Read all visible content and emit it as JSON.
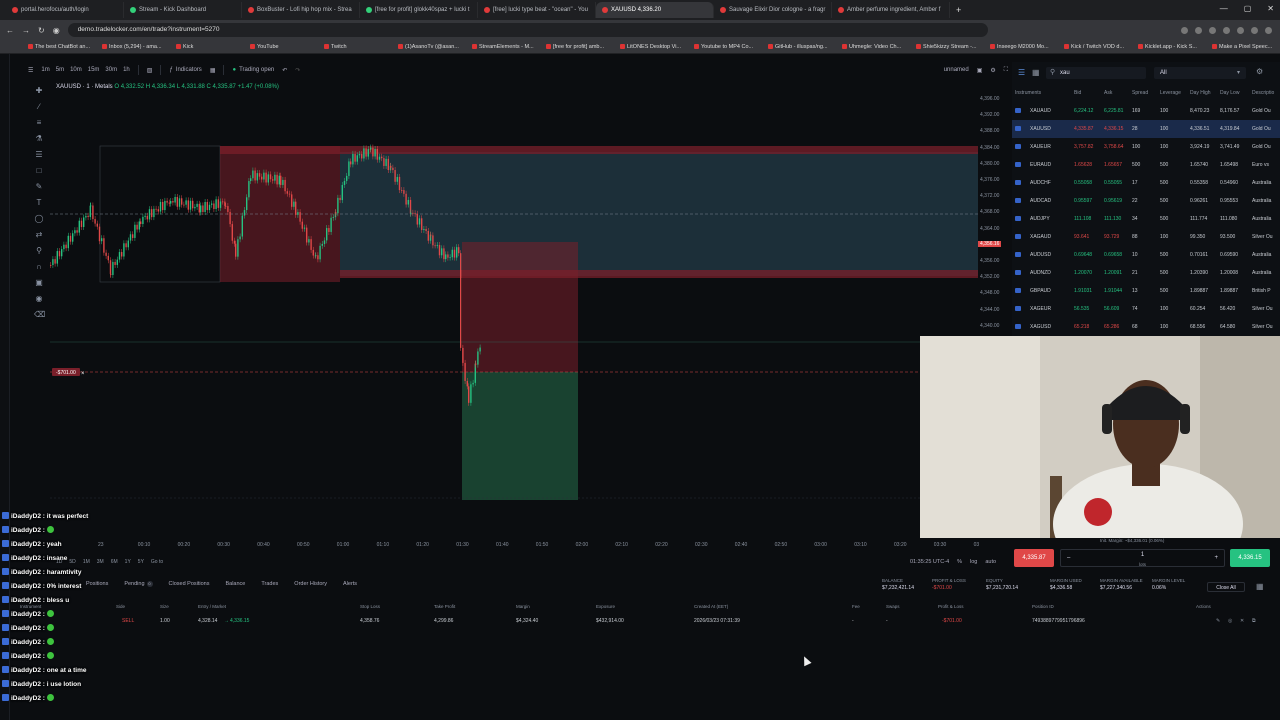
{
  "browser": {
    "tabs": [
      {
        "title": "portal.herofocu/auth/login",
        "active": false
      },
      {
        "title": "Stream - Kick Dashboard",
        "active": false
      },
      {
        "title": "BoxBuster - Lofi hip hop mix - Strea",
        "active": false
      },
      {
        "title": "[free for profit] glokk40spaz + lucki t",
        "active": false
      },
      {
        "title": "[free] lucki type beat - \"ocean\" - You",
        "active": false
      },
      {
        "title": "XAUUSD 4,336.20",
        "active": true
      },
      {
        "title": "Sauvage Elixir Dior cologne - a fragr",
        "active": false
      },
      {
        "title": "Amber perfume ingredient, Amber f",
        "active": false
      }
    ],
    "url": "demo.tradelocker.com/en/trade?instrument=5270",
    "bookmarks": [
      "The best ChatBot an...",
      "Inbox (5,294) - ama...",
      "Kick",
      "YouTube",
      "Twitch",
      "(1)AsanoTv (@asan...",
      "StreamElements - M...",
      "[free for profit] amb...",
      "LitONES Desktop Vi...",
      "Youtube to MP4 Co...",
      "GitHub - illuspas/ng...",
      "Uhmegle: Video Ch...",
      "Shie5kizzy Stream -...",
      "Inseego M2000 Mo...",
      "Kick / Twitch VOD d...",
      "Kicklet.app - Kick S...",
      "Make a Pixel Speec..."
    ]
  },
  "toolbar": {
    "timeframes": [
      "1m",
      "5m",
      "10m",
      "15m",
      "30m",
      "1h"
    ],
    "indicators_label": "Indicators",
    "trading_status": "Trading open",
    "layout_name": "unnamed"
  },
  "symbol": {
    "title": "XAUUSD · 1 · Metals",
    "ohlc": "O 4,332.52  H 4,336.34  L 4,331.88  C 4,335.87  +1.47 (+0.08%)"
  },
  "chart_data": {
    "type": "candlestick",
    "y_ticks": [
      "4,396.00",
      "4,392.00",
      "4,388.00",
      "4,384.00",
      "4,380.00",
      "4,376.00",
      "4,372.00",
      "4,368.00",
      "4,364.00",
      "4,360.00",
      "4,356.00",
      "4,352.00",
      "4,348.00",
      "4,344.00",
      "4,340.00"
    ],
    "x_ticks": [
      "23",
      "00:10",
      "00:20",
      "00:30",
      "00:40",
      "00:50",
      "01:00",
      "01:10",
      "01:20",
      "01:30",
      "01:40",
      "01:50",
      "02:00",
      "02:10",
      "02:20",
      "02:30",
      "02:40",
      "02:50",
      "03:00",
      "03:10",
      "03:20",
      "03:30",
      "03"
    ],
    "current_price_tag": "4,356.16",
    "position_tag": "-$701.00",
    "time_label": "01:35:25 UTC-4",
    "footer_opts": [
      "%",
      "log",
      "auto"
    ],
    "range_buttons": [
      "1D",
      "5D",
      "1M",
      "3M",
      "6M",
      "1Y",
      "5Y",
      "Go to"
    ]
  },
  "instruments": {
    "search": "xau",
    "filter": "All",
    "columns": [
      "Instruments",
      "Bid",
      "Ask",
      "Spread",
      "Leverage",
      "Day High",
      "Day Low",
      "Descriptio"
    ],
    "rows": [
      {
        "sym": "XAUAUD",
        "bid": "6,224.12",
        "ask": "6,225.81",
        "spread": "169",
        "lev": "100",
        "hi": "8,470.23",
        "lo": "8,176.57",
        "desc": "Gold Ou",
        "up": true,
        "sel": false
      },
      {
        "sym": "XAUUSD",
        "bid": "4,335.87",
        "ask": "4,336.15",
        "spread": "28",
        "lev": "100",
        "hi": "4,336.51",
        "lo": "4,319.84",
        "desc": "Gold Ou",
        "up": false,
        "sel": true
      },
      {
        "sym": "XAUEUR",
        "bid": "3,757.82",
        "ask": "3,758.64",
        "spread": "100",
        "lev": "100",
        "hi": "3,924.19",
        "lo": "3,741.49",
        "desc": "Gold Ou",
        "up": false,
        "sel": false
      },
      {
        "sym": "EURAUD",
        "bid": "1.65628",
        "ask": "1.65657",
        "spread": "500",
        "lev": "500",
        "hi": "1.65740",
        "lo": "1.65498",
        "desc": "Euro vs",
        "up": false,
        "sel": false
      },
      {
        "sym": "AUDCHF",
        "bid": "0.55058",
        "ask": "0.55055",
        "spread": "17",
        "lev": "500",
        "hi": "0.55358",
        "lo": "0.54960",
        "desc": "Australia",
        "up": true,
        "sel": false
      },
      {
        "sym": "AUDCAD",
        "bid": "0.95597",
        "ask": "0.95619",
        "spread": "22",
        "lev": "500",
        "hi": "0.96261",
        "lo": "0.95553",
        "desc": "Australia",
        "up": true,
        "sel": false
      },
      {
        "sym": "AUDJPY",
        "bid": "111.108",
        "ask": "111.130",
        "spread": "34",
        "lev": "500",
        "hi": "111.774",
        "lo": "111.080",
        "desc": "Australia",
        "up": true,
        "sel": false
      },
      {
        "sym": "XAGAUD",
        "bid": "93.641",
        "ask": "93.729",
        "spread": "88",
        "lev": "100",
        "hi": "99.350",
        "lo": "93.500",
        "desc": "Silver Ou",
        "up": false,
        "sel": false
      },
      {
        "sym": "AUDUSD",
        "bid": "0.69648",
        "ask": "0.69658",
        "spread": "10",
        "lev": "500",
        "hi": "0.70161",
        "lo": "0.69590",
        "desc": "Australia",
        "up": true,
        "sel": false
      },
      {
        "sym": "AUDNZD",
        "bid": "1.20070",
        "ask": "1.20091",
        "spread": "21",
        "lev": "500",
        "hi": "1.20390",
        "lo": "1.20008",
        "desc": "Australia",
        "up": true,
        "sel": false
      },
      {
        "sym": "GBPAUD",
        "bid": "1.91031",
        "ask": "1.91044",
        "spread": "13",
        "lev": "500",
        "hi": "1.89887",
        "lo": "1.89887",
        "desc": "British P",
        "up": true,
        "sel": false
      },
      {
        "sym": "XAGEUR",
        "bid": "56.535",
        "ask": "56.609",
        "spread": "74",
        "lev": "100",
        "hi": "60.254",
        "lo": "56.420",
        "desc": "Silver Ou",
        "up": true,
        "sel": false
      },
      {
        "sym": "XAGUSD",
        "bid": "65.218",
        "ask": "65.286",
        "spread": "68",
        "lev": "100",
        "hi": "68.556",
        "lo": "64.580",
        "desc": "Silver Ou",
        "up": false,
        "sel": false
      }
    ]
  },
  "ticket": {
    "sell_price": "4,335.87",
    "sell_label": "Sell",
    "buy_price": "4,336.15",
    "buy_label": "Buy",
    "lots": "1",
    "lots_unit": "lots",
    "margin_note": "Init. Margin: ~$4,336.01 (0.06%)"
  },
  "bottom": {
    "tabs": [
      "Positions",
      "Pending",
      "Closed Positions",
      "Balance",
      "Trades",
      "Order History",
      "Alerts"
    ],
    "pending_count": "0",
    "account": [
      {
        "label": "BALANCE",
        "value": "$7,232,421.14",
        "neg": false
      },
      {
        "label": "PROFIT & LOSS",
        "value": "-$701.00",
        "neg": true
      },
      {
        "label": "EQUITY",
        "value": "$7,231,720.14",
        "neg": false
      },
      {
        "label": "MARGIN USED",
        "value": "$4,336.58",
        "neg": false
      },
      {
        "label": "MARGIN AVAILABLE",
        "value": "$7,227,340.56",
        "neg": false
      },
      {
        "label": "MARGIN LEVEL",
        "value": "0.06%",
        "neg": false
      }
    ],
    "close_all": "Close All",
    "columns": [
      "Instrument",
      "Side",
      "Size",
      "Entry / Market",
      "Stop Loss",
      "Take Profit",
      "Margin",
      "Exposure",
      "Created At (EET)",
      "Fee",
      "Swaps",
      "Profit & Loss",
      "Position ID",
      "Actions"
    ],
    "position": {
      "side": "SELL",
      "size": "1.00",
      "entry": "4,328.14",
      "market": "4,336.15",
      "sl": "4,358.76",
      "tp": "4,299.86",
      "margin": "$4,324.40",
      "exposure": "$432,914.00",
      "created": "2026/03/23 07:31:39",
      "fee": "-",
      "swaps": "-",
      "pnl": "-$701.00",
      "id": "7493889779951796896"
    }
  },
  "chat": [
    {
      "user": "iDaddyD2",
      "text": "it was perfect"
    },
    {
      "user": "iDaddyD2",
      "text": ""
    },
    {
      "user": "iDaddyD2",
      "text": "yeah"
    },
    {
      "user": "iDaddyD2",
      "text": "insane"
    },
    {
      "user": "iDaddyD2",
      "text": "haramtivity"
    },
    {
      "user": "iDaddyD2",
      "text": "0% interest"
    },
    {
      "user": "iDaddyD2",
      "text": "bless u"
    },
    {
      "user": "iDaddyD2",
      "text": ""
    },
    {
      "user": "iDaddyD2",
      "text": ""
    },
    {
      "user": "iDaddyD2",
      "text": ""
    },
    {
      "user": "iDaddyD2",
      "text": ""
    },
    {
      "user": "iDaddyD2",
      "text": "one at a time"
    },
    {
      "user": "iDaddyD2",
      "text": "i use lotion"
    },
    {
      "user": "iDaddyD2",
      "text": ""
    }
  ]
}
